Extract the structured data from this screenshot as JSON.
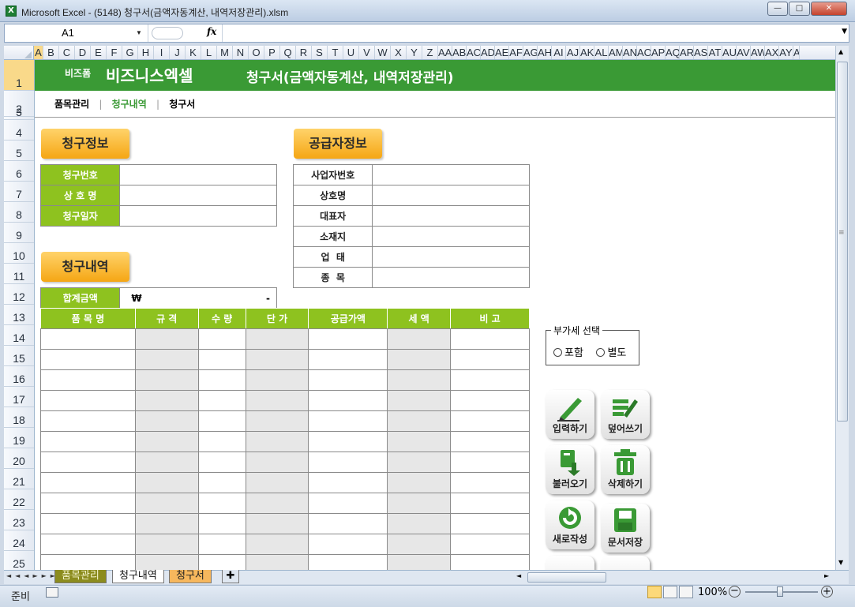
{
  "window": {
    "title": "Microsoft Excel - (5148) 청구서(금액자동계산, 내역저장관리).xlsm",
    "app_icon": "excel-icon",
    "min": "—",
    "max": "□",
    "close": "✕"
  },
  "formula_bar": {
    "name_box": "A1",
    "fx": "fx",
    "formula": ""
  },
  "columns": [
    "A",
    "B",
    "C",
    "D",
    "E",
    "F",
    "G",
    "H",
    "I",
    "J",
    "K",
    "L",
    "M",
    "N",
    "O",
    "P",
    "Q",
    "R",
    "S",
    "T",
    "U",
    "V",
    "W",
    "X",
    "Y",
    "Z",
    "AA",
    "AB",
    "AC",
    "AD",
    "AE",
    "AF",
    "AG",
    "AH",
    "AI",
    "AJ",
    "AK",
    "AL",
    "AM",
    "AN",
    "AO",
    "AP",
    "AQ",
    "AR",
    "AS",
    "AT",
    "AU",
    "AV",
    "AW",
    "AX",
    "AY",
    "A"
  ],
  "rows": [
    "1",
    "2",
    "3",
    "4",
    "5",
    "6",
    "7",
    "8",
    "9",
    "10",
    "11",
    "12",
    "13",
    "14",
    "15",
    "16",
    "17",
    "18",
    "19",
    "20",
    "21",
    "22",
    "23",
    "24",
    "25"
  ],
  "banner": {
    "brand_small": "비즈폼",
    "brand_big": "비즈니스엑셀",
    "title": "청구서(금액자동계산, 내역저장관리)"
  },
  "nav": {
    "items": [
      "품목관리",
      "청구내역",
      "청구서"
    ],
    "separator": "|"
  },
  "billing_info": {
    "heading": "청구정보",
    "fields": [
      {
        "label": "청구번호",
        "value": ""
      },
      {
        "label": "상 호 명",
        "value": ""
      },
      {
        "label": "청구일자",
        "value": ""
      }
    ]
  },
  "supplier_info": {
    "heading": "공급자정보",
    "fields": [
      {
        "label": "사업자번호",
        "value": ""
      },
      {
        "label": "상호명",
        "value": ""
      },
      {
        "label": "대표자",
        "value": ""
      },
      {
        "label": "소재지",
        "value": ""
      },
      {
        "label": "업  태",
        "value": ""
      },
      {
        "label": "종  목",
        "value": ""
      }
    ]
  },
  "billing_details": {
    "heading": "청구내역",
    "total_label": "합계금액",
    "total_currency": "₩",
    "total_value": "-",
    "columns": [
      "품 목 명",
      "규 격",
      "수 량",
      "단 가",
      "공급가액",
      "세 액",
      "비 고"
    ]
  },
  "vat": {
    "legend": "부가세 선택",
    "options": [
      "포함",
      "별도"
    ]
  },
  "tools": [
    {
      "label": "입력하기",
      "icon": "pen-icon"
    },
    {
      "label": "덮어쓰기",
      "icon": "overwrite-icon"
    },
    {
      "label": "불러오기",
      "icon": "load-icon"
    },
    {
      "label": "삭제하기",
      "icon": "trash-icon"
    },
    {
      "label": "새로작성",
      "icon": "refresh-icon"
    },
    {
      "label": "문서저장",
      "icon": "save-icon"
    }
  ],
  "sheet_tabs": [
    "품목관리",
    "청구내역",
    "청구서"
  ],
  "status": {
    "ready": "준비",
    "zoom": "100%"
  },
  "colors": {
    "banner": "#3a9a35",
    "label_green": "#8ec21f",
    "section_orange": "#f5a614"
  }
}
